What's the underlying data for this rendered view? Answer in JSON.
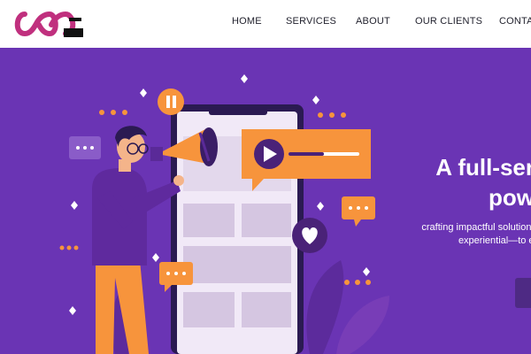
{
  "header": {
    "logo_icon": "infinity-logo-icon",
    "nav": [
      {
        "label": "HOME"
      },
      {
        "label": "SERVICES"
      },
      {
        "label": "ABOUT"
      },
      {
        "label": "OUR CLIENTS"
      },
      {
        "label": "CONTACT"
      }
    ]
  },
  "hero": {
    "headline_line1": "A full-ser",
    "headline_line2": "pow",
    "subtext_line1": "crafting impactful solutions",
    "subtext_line2": "experiential—to el",
    "colors": {
      "background": "#6a34b4",
      "accent_orange": "#f7943c",
      "logo_pink": "#c0307e"
    },
    "icons": [
      "pause-icon",
      "play-icon",
      "heart-icon",
      "megaphone-icon",
      "chat-bubble-icon"
    ]
  }
}
